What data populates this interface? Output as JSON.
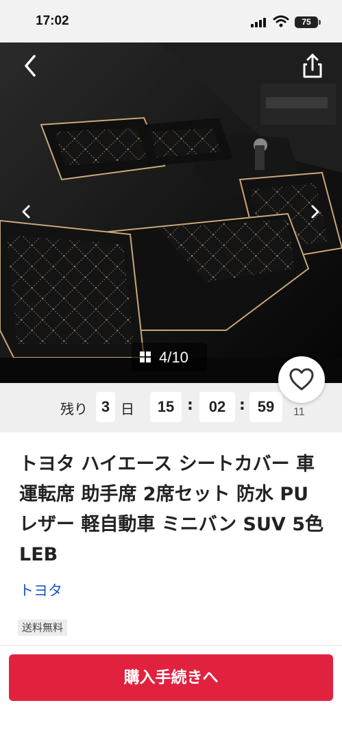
{
  "status_bar": {
    "time": "17:02",
    "battery": "75"
  },
  "gallery": {
    "counter": "4/10"
  },
  "countdown": {
    "prefix": "残り",
    "days": "3",
    "days_unit": "日",
    "hours": "15",
    "sep1": ":",
    "minutes": "02",
    "sep2": ":",
    "seconds": "59"
  },
  "likes": {
    "count": "11"
  },
  "product": {
    "title": "トヨタ ハイエース シートカバー 車 運転席 助手席 2席セット 防水 PUレザー 軽自動車 ミニバン SUV 5色 LEB",
    "brand": "トヨタ",
    "shipping_badge": "送料無料"
  },
  "actions": {
    "buy_label": "購入手続きへ"
  },
  "colors": {
    "buy_button": "#e0223f",
    "brand_link": "#1a56c7",
    "stitch": "#c9a77a"
  },
  "icons": [
    "back-icon",
    "share-icon",
    "prev-icon",
    "next-icon",
    "grid-icon",
    "heart-icon"
  ]
}
